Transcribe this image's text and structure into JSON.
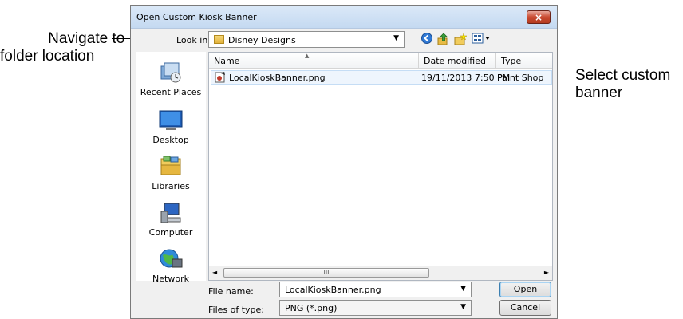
{
  "annotations": {
    "left_line1": "Navigate to",
    "left_line2": "folder location",
    "right_line1": "Select custom",
    "right_line2": "banner"
  },
  "dialog": {
    "title": "Open Custom Kiosk Banner",
    "close_glyph": "×",
    "look_in_label": "Look in:",
    "look_in_value": "Disney Designs",
    "toolbar_icons": [
      "back-icon",
      "up-folder-icon",
      "new-folder-icon",
      "views-menu-icon"
    ]
  },
  "places": [
    {
      "label": "Recent Places",
      "icon": "recent-places-icon"
    },
    {
      "label": "Desktop",
      "icon": "desktop-icon"
    },
    {
      "label": "Libraries",
      "icon": "libraries-icon"
    },
    {
      "label": "Computer",
      "icon": "computer-icon"
    },
    {
      "label": "Network",
      "icon": "network-icon"
    }
  ],
  "columns": {
    "name": "Name",
    "date": "Date modified",
    "type": "Type"
  },
  "files": [
    {
      "name": "LocalKioskBanner.png",
      "date": "19/11/2013 7:50 PM",
      "type": "Paint Shop"
    }
  ],
  "scroll_grip": "III",
  "footer": {
    "file_name_label": "File name:",
    "file_name_value": "LocalKioskBanner.png",
    "file_type_label": "Files of type:",
    "file_type_value": "PNG (*.png)",
    "open_label": "Open",
    "cancel_label": "Cancel"
  },
  "colors": {
    "title_gradient_top": "#dbe9f8",
    "close_red": "#c94a30",
    "selection": "#eef5fd"
  }
}
